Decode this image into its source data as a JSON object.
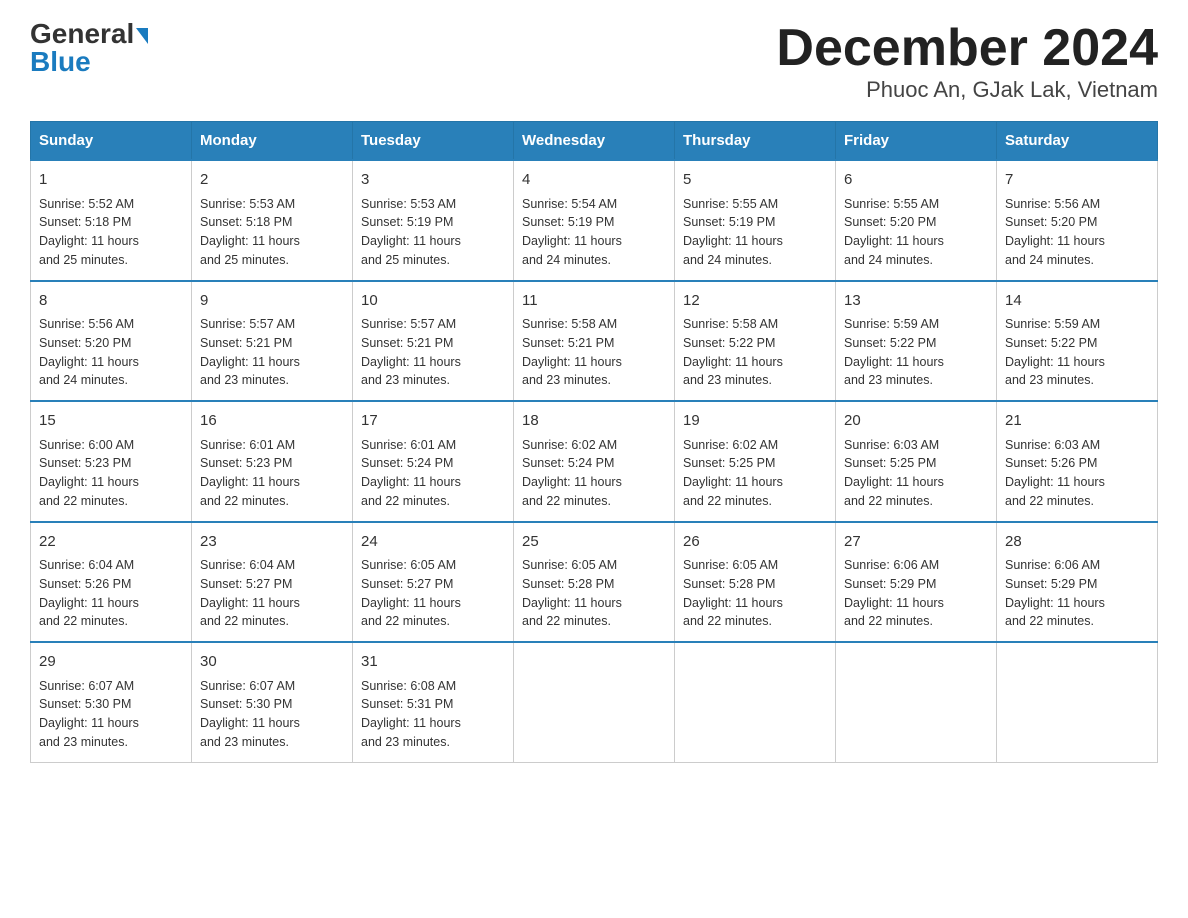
{
  "header": {
    "logo_general": "General",
    "logo_blue": "Blue",
    "title": "December 2024",
    "subtitle": "Phuoc An, GJak Lak, Vietnam"
  },
  "days_of_week": [
    "Sunday",
    "Monday",
    "Tuesday",
    "Wednesday",
    "Thursday",
    "Friday",
    "Saturday"
  ],
  "weeks": [
    [
      {
        "day": "1",
        "sunrise": "5:52 AM",
        "sunset": "5:18 PM",
        "daylight": "11 hours and 25 minutes."
      },
      {
        "day": "2",
        "sunrise": "5:53 AM",
        "sunset": "5:18 PM",
        "daylight": "11 hours and 25 minutes."
      },
      {
        "day": "3",
        "sunrise": "5:53 AM",
        "sunset": "5:19 PM",
        "daylight": "11 hours and 25 minutes."
      },
      {
        "day": "4",
        "sunrise": "5:54 AM",
        "sunset": "5:19 PM",
        "daylight": "11 hours and 24 minutes."
      },
      {
        "day": "5",
        "sunrise": "5:55 AM",
        "sunset": "5:19 PM",
        "daylight": "11 hours and 24 minutes."
      },
      {
        "day": "6",
        "sunrise": "5:55 AM",
        "sunset": "5:20 PM",
        "daylight": "11 hours and 24 minutes."
      },
      {
        "day": "7",
        "sunrise": "5:56 AM",
        "sunset": "5:20 PM",
        "daylight": "11 hours and 24 minutes."
      }
    ],
    [
      {
        "day": "8",
        "sunrise": "5:56 AM",
        "sunset": "5:20 PM",
        "daylight": "11 hours and 24 minutes."
      },
      {
        "day": "9",
        "sunrise": "5:57 AM",
        "sunset": "5:21 PM",
        "daylight": "11 hours and 23 minutes."
      },
      {
        "day": "10",
        "sunrise": "5:57 AM",
        "sunset": "5:21 PM",
        "daylight": "11 hours and 23 minutes."
      },
      {
        "day": "11",
        "sunrise": "5:58 AM",
        "sunset": "5:21 PM",
        "daylight": "11 hours and 23 minutes."
      },
      {
        "day": "12",
        "sunrise": "5:58 AM",
        "sunset": "5:22 PM",
        "daylight": "11 hours and 23 minutes."
      },
      {
        "day": "13",
        "sunrise": "5:59 AM",
        "sunset": "5:22 PM",
        "daylight": "11 hours and 23 minutes."
      },
      {
        "day": "14",
        "sunrise": "5:59 AM",
        "sunset": "5:22 PM",
        "daylight": "11 hours and 23 minutes."
      }
    ],
    [
      {
        "day": "15",
        "sunrise": "6:00 AM",
        "sunset": "5:23 PM",
        "daylight": "11 hours and 22 minutes."
      },
      {
        "day": "16",
        "sunrise": "6:01 AM",
        "sunset": "5:23 PM",
        "daylight": "11 hours and 22 minutes."
      },
      {
        "day": "17",
        "sunrise": "6:01 AM",
        "sunset": "5:24 PM",
        "daylight": "11 hours and 22 minutes."
      },
      {
        "day": "18",
        "sunrise": "6:02 AM",
        "sunset": "5:24 PM",
        "daylight": "11 hours and 22 minutes."
      },
      {
        "day": "19",
        "sunrise": "6:02 AM",
        "sunset": "5:25 PM",
        "daylight": "11 hours and 22 minutes."
      },
      {
        "day": "20",
        "sunrise": "6:03 AM",
        "sunset": "5:25 PM",
        "daylight": "11 hours and 22 minutes."
      },
      {
        "day": "21",
        "sunrise": "6:03 AM",
        "sunset": "5:26 PM",
        "daylight": "11 hours and 22 minutes."
      }
    ],
    [
      {
        "day": "22",
        "sunrise": "6:04 AM",
        "sunset": "5:26 PM",
        "daylight": "11 hours and 22 minutes."
      },
      {
        "day": "23",
        "sunrise": "6:04 AM",
        "sunset": "5:27 PM",
        "daylight": "11 hours and 22 minutes."
      },
      {
        "day": "24",
        "sunrise": "6:05 AM",
        "sunset": "5:27 PM",
        "daylight": "11 hours and 22 minutes."
      },
      {
        "day": "25",
        "sunrise": "6:05 AM",
        "sunset": "5:28 PM",
        "daylight": "11 hours and 22 minutes."
      },
      {
        "day": "26",
        "sunrise": "6:05 AM",
        "sunset": "5:28 PM",
        "daylight": "11 hours and 22 minutes."
      },
      {
        "day": "27",
        "sunrise": "6:06 AM",
        "sunset": "5:29 PM",
        "daylight": "11 hours and 22 minutes."
      },
      {
        "day": "28",
        "sunrise": "6:06 AM",
        "sunset": "5:29 PM",
        "daylight": "11 hours and 22 minutes."
      }
    ],
    [
      {
        "day": "29",
        "sunrise": "6:07 AM",
        "sunset": "5:30 PM",
        "daylight": "11 hours and 23 minutes."
      },
      {
        "day": "30",
        "sunrise": "6:07 AM",
        "sunset": "5:30 PM",
        "daylight": "11 hours and 23 minutes."
      },
      {
        "day": "31",
        "sunrise": "6:08 AM",
        "sunset": "5:31 PM",
        "daylight": "11 hours and 23 minutes."
      },
      null,
      null,
      null,
      null
    ]
  ],
  "labels": {
    "sunrise": "Sunrise:",
    "sunset": "Sunset:",
    "daylight": "Daylight:"
  }
}
